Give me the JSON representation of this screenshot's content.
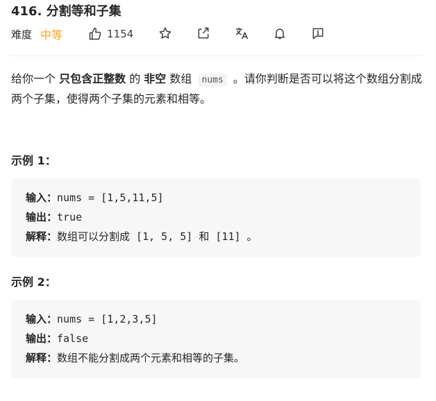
{
  "problem": {
    "title": "416. 分割等和子集",
    "difficulty_label": "难度",
    "difficulty": "中等",
    "likes": "1154"
  },
  "toolbar": {
    "icons": [
      "thumbs-up-icon",
      "star-icon",
      "share-icon",
      "translate-icon",
      "bell-icon",
      "feedback-icon"
    ]
  },
  "description": {
    "p1_a": "给你一个 ",
    "p1_b": "只包含正整数",
    "p1_c": " 的 ",
    "p1_d": "非空",
    "p1_e": " 数组 ",
    "p1_code": "nums",
    "p1_f": " 。请你判断是否可以将这个数组分割成两个子集，使得两个子集的元素和相等。"
  },
  "examples": [
    {
      "title": "示例 1：",
      "input_label": "输入：",
      "input": "nums = [1,5,11,5]",
      "output_label": "输出：",
      "output": "true",
      "explain_label": "解释：",
      "explain": "数组可以分割成 [1, 5, 5] 和 [11] 。"
    },
    {
      "title": "示例 2：",
      "input_label": "输入：",
      "input": "nums = [1,2,3,5]",
      "output_label": "输出：",
      "output": "false",
      "explain_label": "解释：",
      "explain": "数组不能分割成两个元素和相等的子集。"
    }
  ],
  "colors": {
    "difficulty_medium": "#ffa116",
    "code_bg": "#f7f7f8"
  }
}
